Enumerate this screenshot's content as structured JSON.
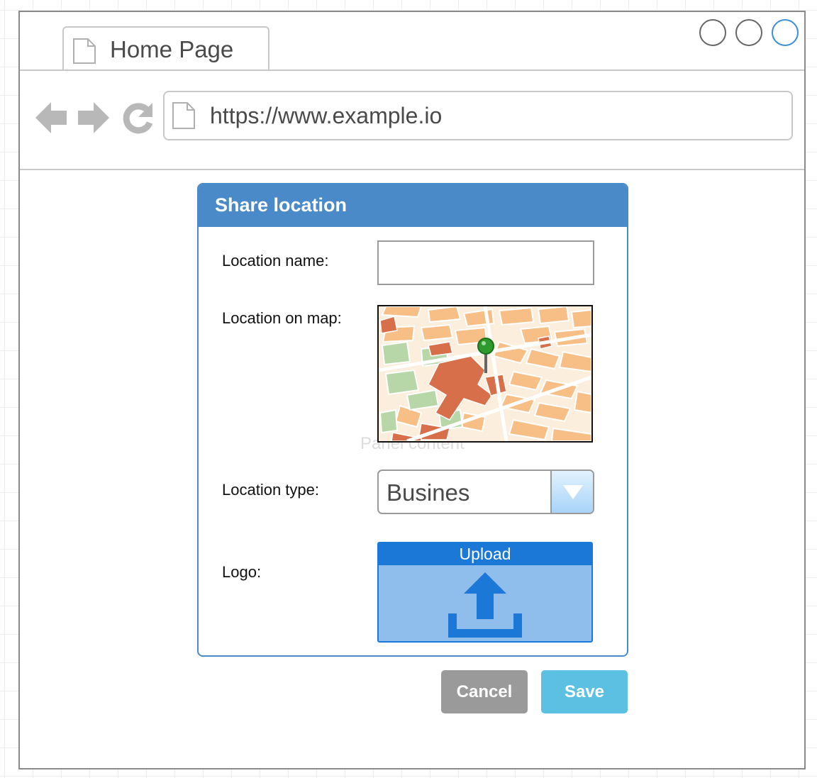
{
  "browser": {
    "tab_title": "Home Page",
    "url": "https://www.example.io",
    "window_controls": [
      "circle-icon",
      "circle-icon",
      "circle-icon"
    ],
    "nav_icons": [
      "back-arrow-icon",
      "forward-arrow-icon",
      "reload-icon"
    ]
  },
  "dialog": {
    "title": "Share location",
    "watermark": "Panel content",
    "fields": {
      "location_name_label": "Location name:",
      "location_name_value": "",
      "location_map_label": "Location on map:",
      "location_type_label": "Location type:",
      "location_type_value": "Busines",
      "logo_label": "Logo:"
    },
    "upload": {
      "label": "Upload",
      "icon": "upload-icon"
    }
  },
  "actions": {
    "cancel": "Cancel",
    "save": "Save"
  },
  "colors": {
    "header_blue": "#4a8ac8",
    "upload_blue": "#1c78d6",
    "cancel_gray": "#9a9a9a",
    "save_cyan": "#5bc0e2"
  }
}
